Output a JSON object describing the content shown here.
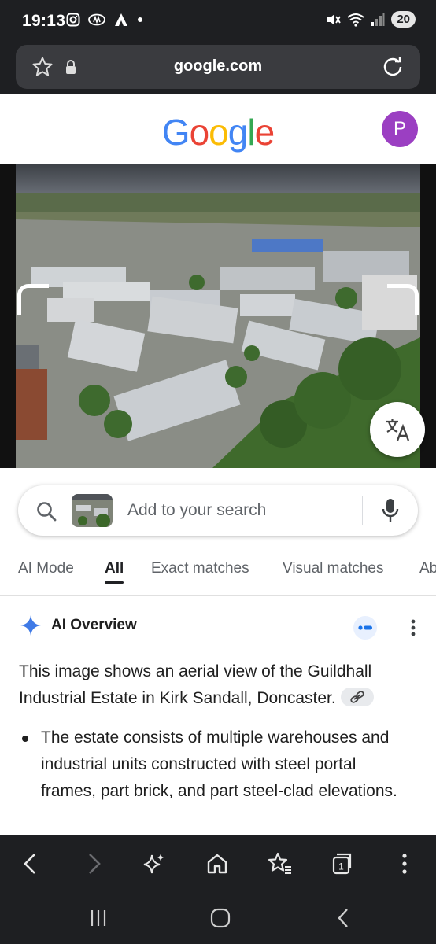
{
  "status_bar": {
    "time": "19:13",
    "battery": "20"
  },
  "browser": {
    "url": "google.com"
  },
  "google": {
    "logo_letters": [
      "G",
      "o",
      "o",
      "g",
      "l",
      "e"
    ],
    "logo_colors": [
      "#4285F4",
      "#EA4335",
      "#FBBC05",
      "#4285F4",
      "#34A853",
      "#EA4335"
    ],
    "avatar_letter": "P",
    "avatar_color": "#9b3fc2"
  },
  "search": {
    "placeholder": "Add to your search"
  },
  "tabs": [
    {
      "label": "AI Mode",
      "active": false
    },
    {
      "label": "All",
      "active": true
    },
    {
      "label": "Exact matches",
      "active": false
    },
    {
      "label": "Visual matches",
      "active": false
    },
    {
      "label": "Ab",
      "active": false
    }
  ],
  "ai_overview": {
    "title": "AI Overview",
    "summary": "This image shows an aerial view of the Guildhall Industrial Estate in Kirk Sandall, Doncaster.",
    "bullets": [
      "The estate consists of multiple warehouses and industrial units constructed with steel portal frames, part brick, and part steel-clad elevations."
    ]
  },
  "icons": {
    "status": [
      "instagram-icon",
      "news-icon",
      "arrow-app-icon",
      "mute-icon",
      "wifi-icon",
      "signal-icon"
    ],
    "url_bar": [
      "star-icon",
      "lock-icon",
      "reload-icon"
    ],
    "toolbar": [
      "back-icon",
      "forward-icon",
      "sparkle-icon",
      "home-icon",
      "bookmarks-icon",
      "tabs-icon",
      "more-icon"
    ],
    "nav": [
      "recents-icon",
      "home-nav-icon",
      "back-nav-icon"
    ]
  },
  "toolbar": {
    "tab_count": "1"
  }
}
